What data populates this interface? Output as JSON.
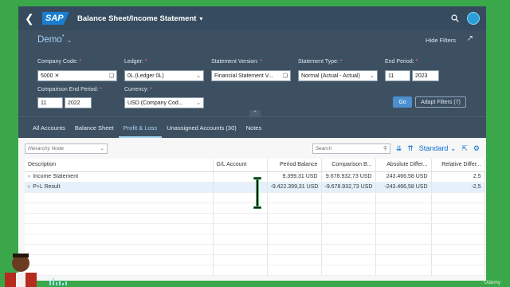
{
  "shell": {
    "back_icon": "back-icon",
    "logo": "SAP",
    "title": "Balance Sheet/Income Statement"
  },
  "header": {
    "variant": "Demo",
    "variant_mark": "*",
    "hide_filters": "Hide Filters",
    "filters": {
      "company_code": {
        "label": "Company Code:",
        "value": "5000"
      },
      "ledger": {
        "label": "Ledger:",
        "value": "0L (Ledger 0L)"
      },
      "statement_version": {
        "label": "Statement Version:",
        "value": "Financial Statement V..."
      },
      "statement_type": {
        "label": "Statement Type:",
        "value": "Normal (Actual - Actual)"
      },
      "end_period": {
        "label": "End Period:",
        "period": "11",
        "year": "2023"
      },
      "comparison_end_period": {
        "label": "Comparison End Period:",
        "period": "11",
        "year": "2022"
      },
      "currency": {
        "label": "Currency:",
        "value": "USD (Company Cod..."
      }
    },
    "required_mark": "*",
    "go": "Go",
    "adapt_filters": "Adapt Filters (7)"
  },
  "tabs": [
    {
      "label": "All Accounts"
    },
    {
      "label": "Balance Sheet"
    },
    {
      "label": "Profit & Loss",
      "active": true
    },
    {
      "label": "Unassigned Accounts (30)"
    },
    {
      "label": "Notes"
    }
  ],
  "toolbar": {
    "hierarchy_placeholder": "Hierarchy Node",
    "search_placeholder": "Search",
    "variant": "Standard"
  },
  "table": {
    "columns": [
      "Description",
      "G/L Account",
      "Period Balance",
      "Comparison B...",
      "Absolute Differ...",
      "Relative Differ..."
    ],
    "rows": [
      {
        "description": "Income Statement",
        "gl": "",
        "period": "9.399,31 USD",
        "comparison": "9.678.932,73 USD",
        "absolute": "243.466,58 USD",
        "relative": "2,5"
      },
      {
        "description": "P+L Result",
        "gl": "",
        "period": "-9.422.399,31 USD",
        "comparison": "-9.678.932,73 USD",
        "absolute": "-243.466,58 USD",
        "relative": "-2,5"
      }
    ]
  },
  "watermark": "Udemy",
  "colors": {
    "shell": "#364b5e",
    "header": "#3d5062",
    "accent": "#a7d4f4",
    "link": "#0a6ed1",
    "background": "#3aa84a"
  }
}
